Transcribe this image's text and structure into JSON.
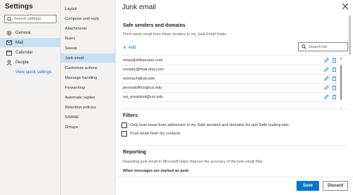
{
  "settings": {
    "title": "Settings",
    "search_placeholder": "Search settings",
    "nav": [
      {
        "label": "General",
        "icon": "gear-icon"
      },
      {
        "label": "Mail",
        "icon": "mail-icon"
      },
      {
        "label": "Calendar",
        "icon": "calendar-icon"
      },
      {
        "label": "People",
        "icon": "people-icon"
      }
    ],
    "view_quick_settings": "View quick settings"
  },
  "mail_menu": [
    "Layout",
    "Compose and reply",
    "Attachments",
    "Rules",
    "Sweep",
    "Junk email",
    "Customize actions",
    "Message handling",
    "Forwarding",
    "Automatic replies",
    "Retention policies",
    "S/MIME",
    "Groups"
  ],
  "panel": {
    "title": "Junk email",
    "safe_heading": "Safe senders and domains",
    "safe_desc": "Don't move email from these senders to my Junk Email folder.",
    "add_label": "Add",
    "search_list_placeholder": "Search list",
    "senders": [
      "news@influenster.com",
      "noreply@mail.etsy.com",
      "outreach@usi.edu",
      "provostoffice@usi.edu",
      "usi_president@usi.edu"
    ],
    "filters_heading": "Filters",
    "filter_options": [
      "Only trust email from addresses in my Safe senders and domains list and Safe mailing lists",
      "Trust email from my contacts"
    ],
    "reporting_heading": "Reporting",
    "reporting_desc": "Reporting junk email to Microsoft helps improve the accuracy of the junk email filter.",
    "when_marked": "When messages are marked as junk:",
    "save_label": "Save",
    "discard_label": "Discard"
  },
  "colors": {
    "accent": "#0078d4",
    "selected_bg": "#c7e0f4"
  }
}
